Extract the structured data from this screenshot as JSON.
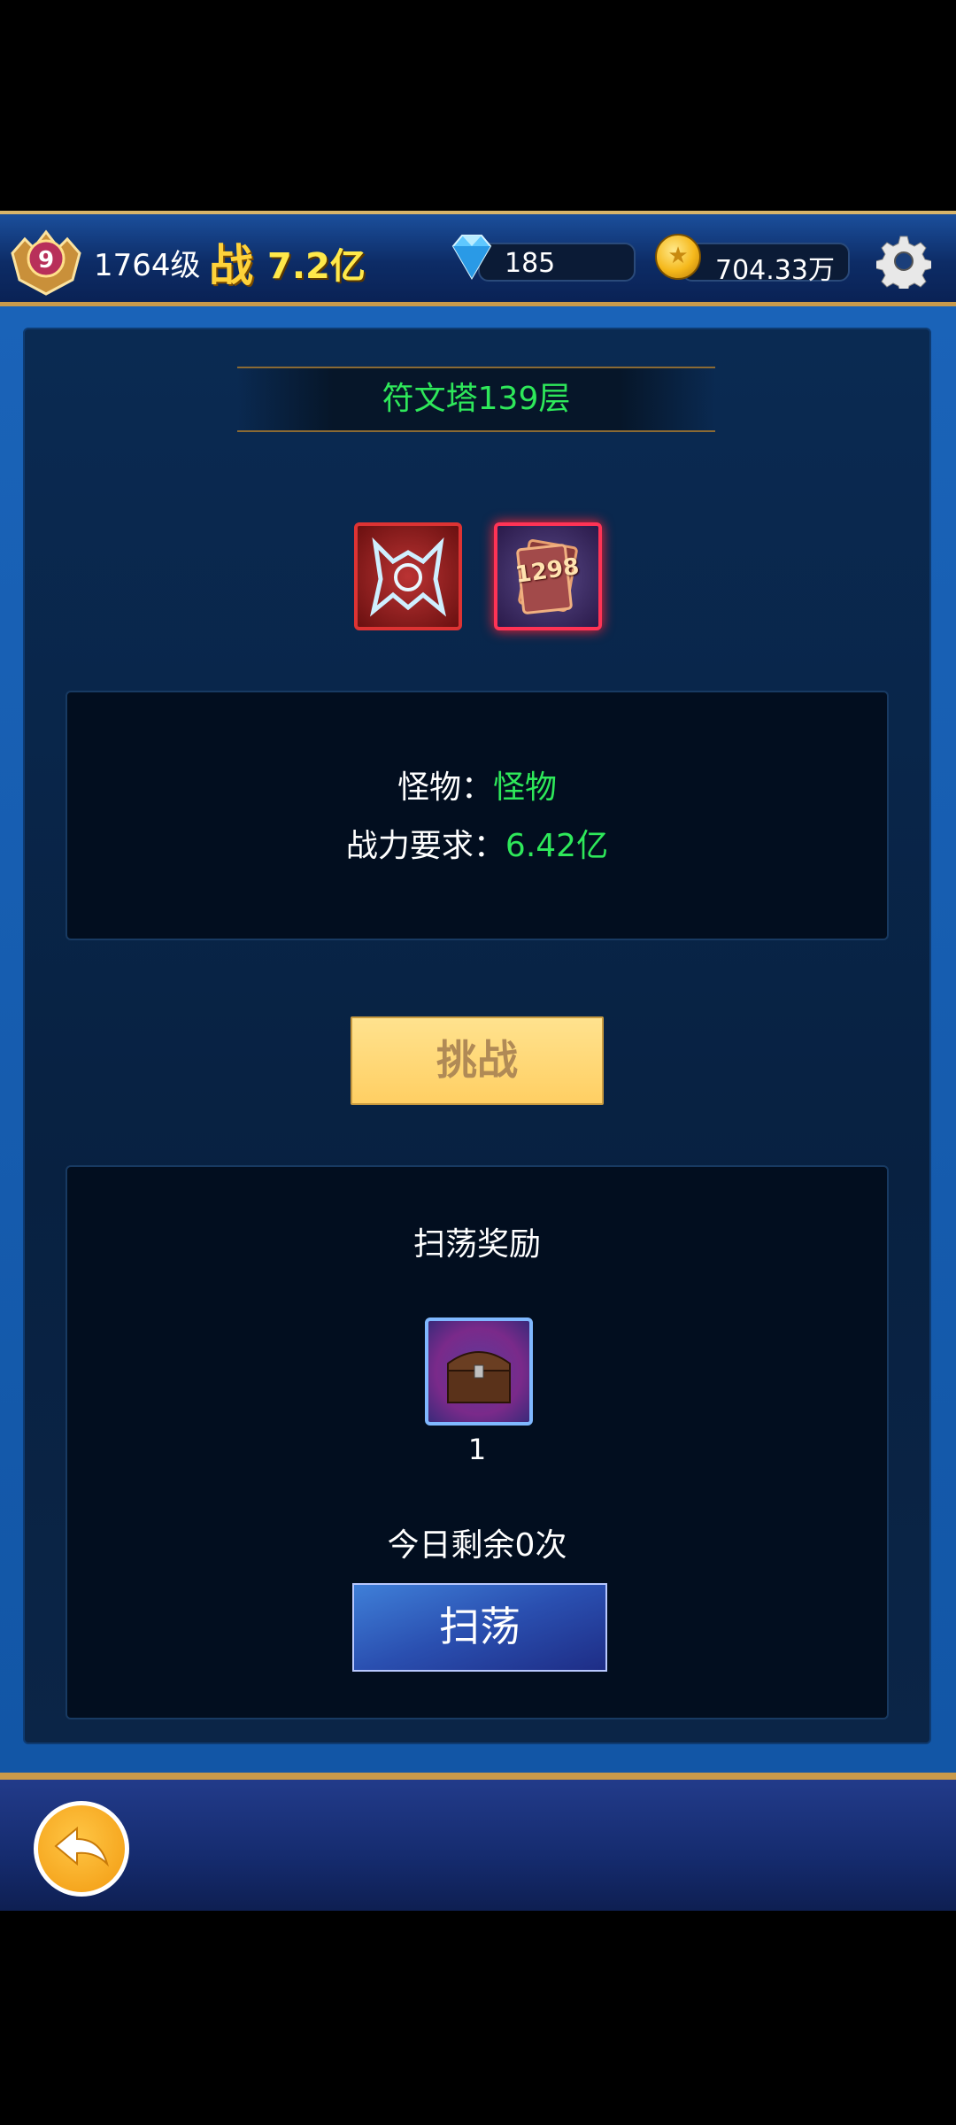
{
  "header": {
    "vip_level": "9",
    "player_level": "1764级",
    "power_label": "战",
    "power_value": "7.2亿",
    "diamonds": "185",
    "gold": "704.33万"
  },
  "stage": {
    "title": "符文塔139层",
    "reward_card_value": "1298",
    "monster_label": "怪物：",
    "monster_value": "怪物",
    "power_req_label": "战力要求：",
    "power_req_value": "6.42亿",
    "challenge_label": "挑战"
  },
  "sweep": {
    "title": "扫荡奖励",
    "reward_count": "1",
    "remaining": "今日剩余0次",
    "button_label": "扫荡"
  },
  "colors": {
    "accent_green": "#2ee85a",
    "gold_text": "#ffe94a"
  },
  "icons": [
    "vip-badge-icon",
    "diamond-icon",
    "gold-coin-icon",
    "settings-gear-icon",
    "monster-icon",
    "card-pack-icon",
    "treasure-chest-icon",
    "back-arrow-icon"
  ]
}
